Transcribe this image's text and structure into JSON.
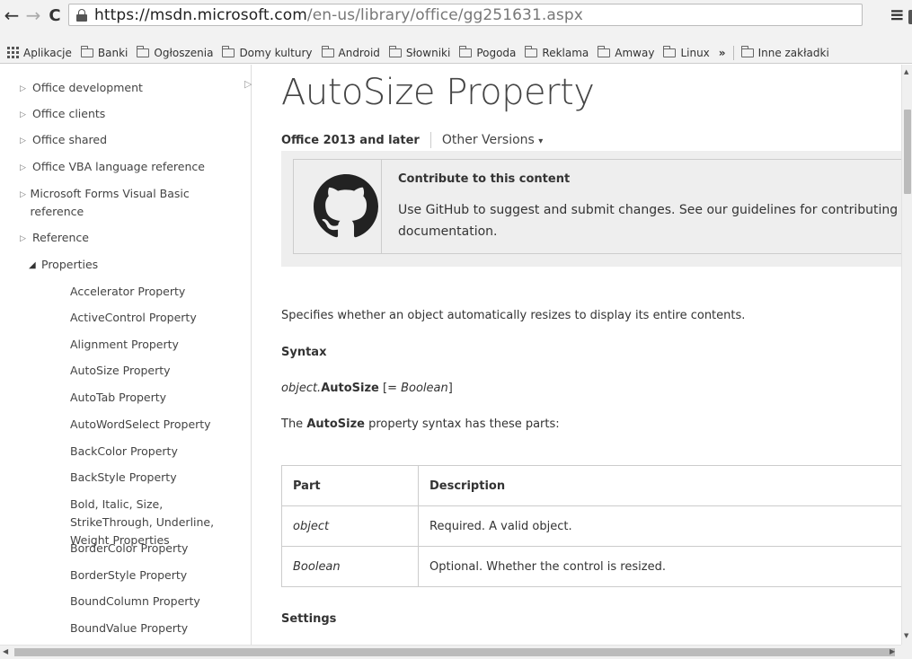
{
  "browser": {
    "url_host": "https://msdn.microsoft.com",
    "url_path": "/en-us/library/office/gg251631.aspx",
    "translate_glyph": "a",
    "bookmarks": [
      {
        "label": "Aplikacje",
        "icon": "apps-icon"
      },
      {
        "label": "Banki",
        "icon": "folder-icon"
      },
      {
        "label": "Ogłoszenia",
        "icon": "folder-icon"
      },
      {
        "label": "Domy kultury",
        "icon": "folder-icon"
      },
      {
        "label": "Android",
        "icon": "folder-icon"
      },
      {
        "label": "Słowniki",
        "icon": "folder-icon"
      },
      {
        "label": "Pogoda",
        "icon": "folder-icon"
      },
      {
        "label": "Reklama",
        "icon": "folder-icon"
      },
      {
        "label": "Amway",
        "icon": "folder-icon"
      },
      {
        "label": "Linux",
        "icon": "folder-icon"
      }
    ],
    "more_bookmarks": "»",
    "other_bookmarks": "Inne zakładki"
  },
  "sidebar": {
    "items": [
      {
        "label": "Office development",
        "level": 1
      },
      {
        "label": "Office clients",
        "level": 1
      },
      {
        "label": "Office shared",
        "level": 1
      },
      {
        "label": "Office VBA language reference",
        "level": 1
      },
      {
        "label": "Microsoft Forms Visual Basic reference",
        "level": 1
      },
      {
        "label": "Reference",
        "level": 1
      },
      {
        "label": "Properties",
        "level": 2
      },
      {
        "label": "Accelerator Property",
        "level": 3
      },
      {
        "label": "ActiveControl Property",
        "level": 3
      },
      {
        "label": "Alignment Property",
        "level": 3
      },
      {
        "label": "AutoSize Property",
        "level": 3
      },
      {
        "label": "AutoTab Property",
        "level": 3
      },
      {
        "label": "AutoWordSelect Property",
        "level": 3
      },
      {
        "label": "BackColor Property",
        "level": 3
      },
      {
        "label": "BackStyle Property",
        "level": 3
      },
      {
        "label": "Bold, Italic, Size, StrikeThrough, Underline, Weight Properties",
        "level": 3
      },
      {
        "label": "BorderColor Property",
        "level": 3
      },
      {
        "label": "BorderStyle Property",
        "level": 3
      },
      {
        "label": "BoundColumn Property",
        "level": 3
      },
      {
        "label": "BoundValue Property",
        "level": 3
      }
    ]
  },
  "main": {
    "title": "AutoSize Property",
    "version_current": "Office 2013 and later",
    "version_other": "Other Versions",
    "contribute": {
      "title": "Contribute to this content",
      "text": "Use GitHub to suggest and submit changes. See our guidelines for contributing to documentation."
    },
    "summary": "Specifies whether an object automatically resizes to display its entire contents.",
    "syntax_heading": "Syntax",
    "syntax_object": "object.",
    "syntax_property": "AutoSize",
    "syntax_open": " [= ",
    "syntax_value": "Boolean",
    "syntax_close": "]",
    "parts_pre": "The ",
    "parts_bold": "AutoSize",
    "parts_post": " property syntax has these parts:",
    "table": {
      "headers": [
        "Part",
        "Description"
      ],
      "rows": [
        [
          "object",
          "Required. A valid object."
        ],
        [
          "Boolean",
          "Optional. Whether the control is resized."
        ]
      ]
    },
    "settings_heading": "Settings"
  }
}
